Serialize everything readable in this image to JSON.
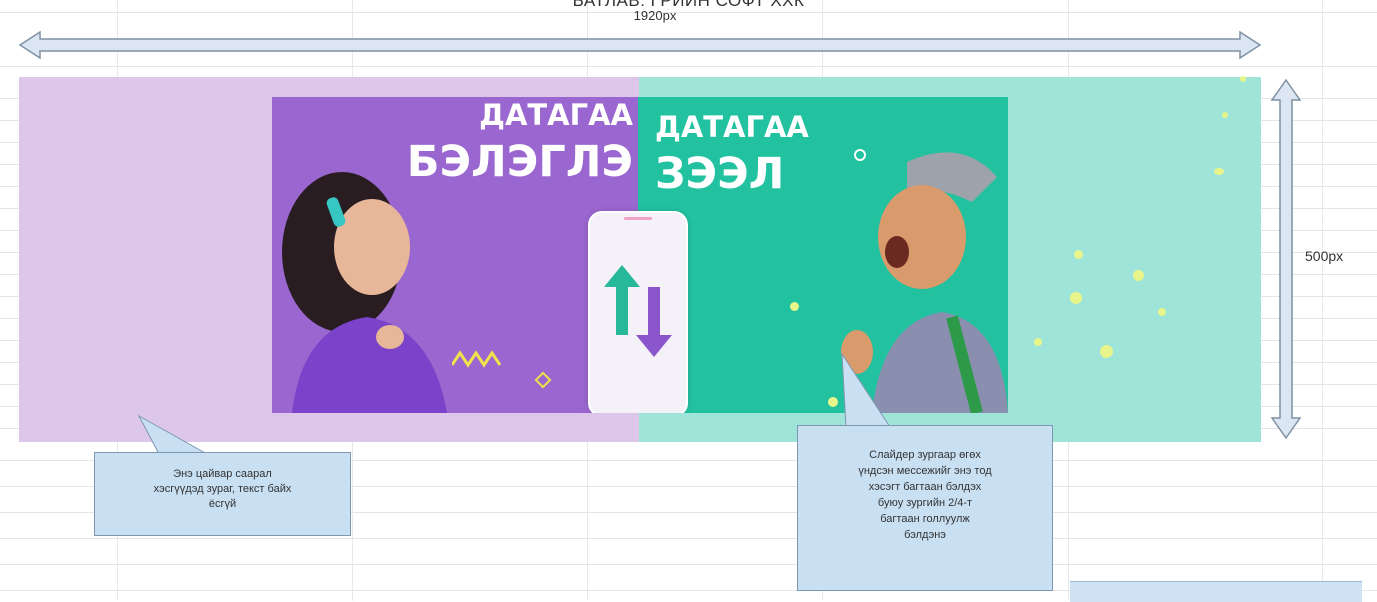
{
  "header": {
    "title": "БАТЛАВ: ГРИЙН СОФТ ХХК",
    "width_label": "1920px"
  },
  "dimension": {
    "height_label": "500px"
  },
  "banner": {
    "left_line1": "ДАТАГАА",
    "left_line2": "БЭЛЭГЛЭ",
    "right_line1": "ДАТАГАА",
    "right_line2": "ЗЭЭЛ"
  },
  "callouts": {
    "left_lines": [
      "Энэ цайвар саарал",
      "хэсгүүдэд зураг, текст байх",
      "ёсгүй"
    ],
    "right_lines": [
      "Слайдер зургаар өгөх",
      "үндсэн мессежийг энэ тод",
      "хэсэгт багтаан бэлдэх",
      "буюу зургийн 2/4-т",
      "багтаан голлуулж",
      "бэлдэнэ"
    ]
  },
  "colors": {
    "canvas_left": "#dcc7ea",
    "canvas_right": "#9fe4d9",
    "banner_left": "#9a66cf",
    "banner_right": "#22c2a0",
    "callout_fill": "#c9dff2",
    "arrow_fill": "#dbe6f2"
  },
  "icons": {
    "width_arrow": "double-headed-horizontal-arrow",
    "height_arrow": "double-headed-vertical-arrow",
    "transfer": "up-down-arrows-icon"
  }
}
